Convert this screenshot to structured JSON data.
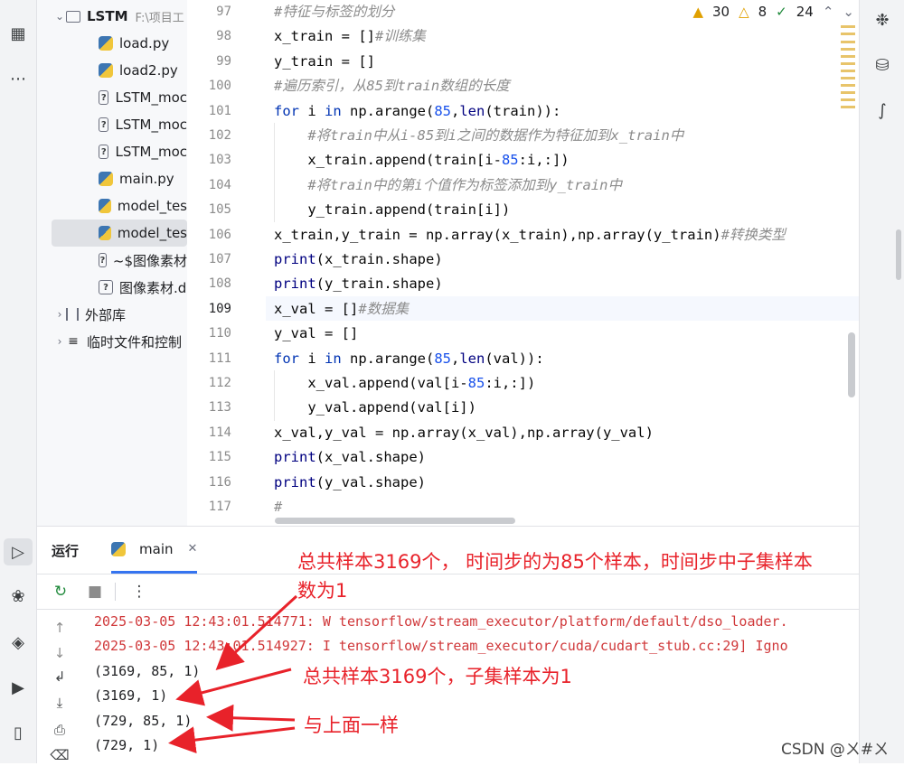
{
  "project": {
    "root_name": "LSTM",
    "root_path": "F:\\项目工",
    "files": [
      {
        "name": "load.py",
        "type": "python",
        "icon": "python-file-icon"
      },
      {
        "name": "load2.py",
        "type": "python",
        "icon": "python-file-icon"
      },
      {
        "name": "LSTM_moc",
        "type": "unknown",
        "icon": "unknown-file-icon"
      },
      {
        "name": "LSTM_moc",
        "type": "unknown",
        "icon": "unknown-file-icon"
      },
      {
        "name": "LSTM_moc",
        "type": "unknown",
        "icon": "unknown-file-icon"
      },
      {
        "name": "main.py",
        "type": "python",
        "icon": "python-file-icon"
      },
      {
        "name": "model_tes",
        "type": "python",
        "icon": "python-file-icon"
      },
      {
        "name": "model_tes",
        "type": "python",
        "icon": "python-file-icon",
        "selected": true
      },
      {
        "name": "~$图像素材",
        "type": "unknown",
        "icon": "unknown-file-icon"
      },
      {
        "name": "图像素材.d",
        "type": "unknown",
        "icon": "unknown-file-icon"
      }
    ],
    "external_libs": "外部库",
    "scratches": "临时文件和控制"
  },
  "inspections": {
    "warnings_a": "30",
    "warnings_b": "8",
    "ok": "24"
  },
  "editor": {
    "line_numbers": [
      "97",
      "98",
      "99",
      "100",
      "101",
      "102",
      "103",
      "104",
      "105",
      "106",
      "107",
      "108",
      "109",
      "110",
      "111",
      "112",
      "113",
      "114",
      "115",
      "116",
      "117"
    ],
    "current_line": "109",
    "lines": [
      "#特征与标签的划分",
      "x_train = []#训练集",
      "y_train = []",
      "#遍历索引，从85到train数组的长度",
      "for i in np.arange(85,len(train)):",
      "    #将train中从i-85到i之间的数据作为特征加到x_train中",
      "    x_train.append(train[i-85:i,:])",
      "    #将train中的第i个值作为标签添加到y_train中",
      "    y_train.append(train[i])",
      "x_train,y_train = np.array(x_train),np.array(y_train)#转换类型",
      "print(x_train.shape)",
      "print(y_train.shape)",
      "x_val = []#数据集",
      "y_val = []",
      "for i in np.arange(85,len(val)):",
      "    x_val.append(val[i-85:i,:])",
      "    y_val.append(val[i])",
      "x_val,y_val = np.array(x_val),np.array(y_val)",
      "print(x_val.shape)",
      "print(y_val.shape)",
      "#"
    ]
  },
  "run": {
    "title": "运行",
    "tab_label": "main",
    "output": [
      {
        "text": "2025-03-05 12:43:01.514771: W tensorflow/stream_executor/platform/default/dso_loader.",
        "kind": "err"
      },
      {
        "text": "2025-03-05 12:43:01.514927: I tensorflow/stream_executor/cuda/cudart_stub.cc:29] Igno",
        "kind": "err"
      },
      {
        "text": "(3169, 85, 1)",
        "kind": "out"
      },
      {
        "text": "(3169, 1)",
        "kind": "out"
      },
      {
        "text": "(729, 85, 1)",
        "kind": "out"
      },
      {
        "text": "(729, 1)",
        "kind": "out"
      }
    ]
  },
  "annotations": {
    "note1_line1": "总共样本3169个， 时间步的为85个样本，时间步中子集样本",
    "note1_line2": "数为1",
    "note2": "总共样本3169个，子集样本为1",
    "note3": "与上面一样"
  },
  "watermark": "CSDN @ㄨ#ㄨ",
  "colors": {
    "accent": "#3574f0",
    "error_text": "#d0383a",
    "annotation": "#e8222a",
    "keyword": "#0033b3",
    "number": "#1750eb"
  }
}
